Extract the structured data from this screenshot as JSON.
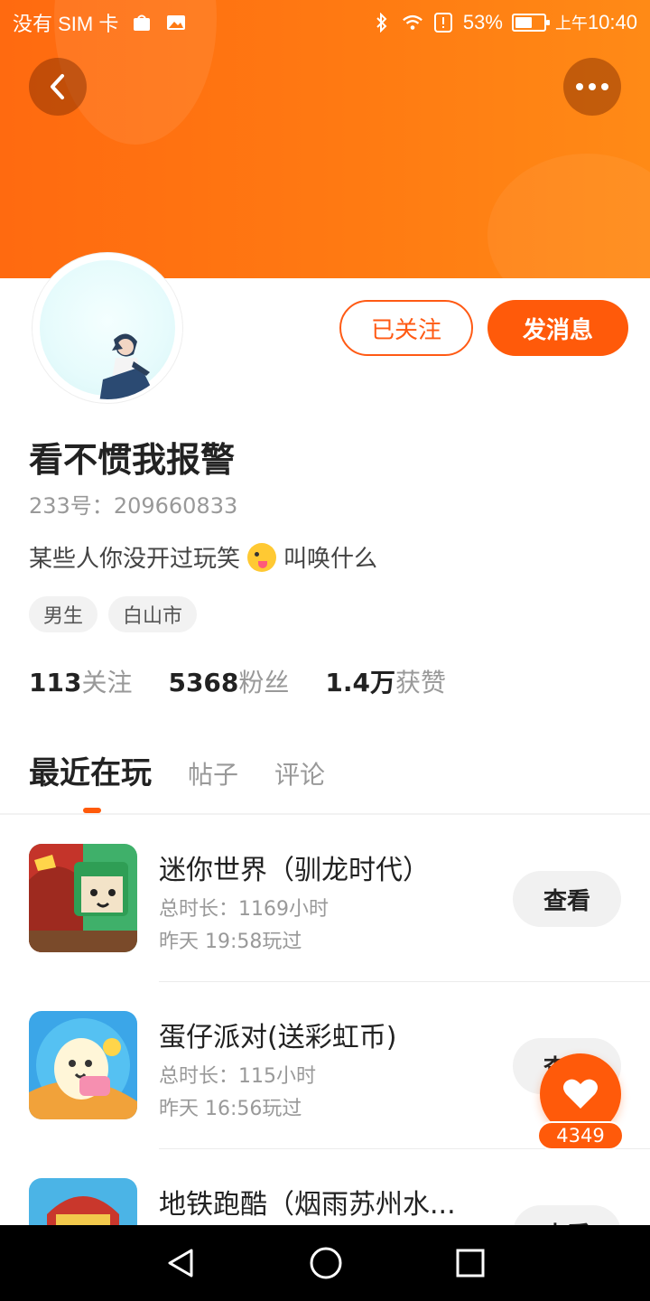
{
  "status_bar": {
    "carrier": "没有 SIM 卡",
    "battery": "53%",
    "time_prefix": "上午",
    "time": "10:40"
  },
  "header": {
    "back_icon": "chevron-left-icon",
    "more_icon": "more-dots-icon"
  },
  "profile": {
    "name": "看不惯我报警",
    "uid_label": "233号：",
    "uid": "209660833",
    "bio_before": "某些人你没开过玩笑",
    "bio_after": " 叫唤什么",
    "tags": [
      "男生",
      "白山市"
    ],
    "follow_button": "已关注",
    "message_button": "发消息"
  },
  "stats": {
    "following_count": "113",
    "following_label": "关注",
    "fans_count": "5368",
    "fans_label": "粉丝",
    "likes_count": "1.4万",
    "likes_label": "获赞"
  },
  "tabs": {
    "active": "最近在玩",
    "posts": "帖子",
    "comments": "评论"
  },
  "games": [
    {
      "title": "迷你世界（驯龙时代）",
      "duration": "总时长：1169小时",
      "last_played": "昨天 19:58玩过",
      "button": "查看"
    },
    {
      "title": "蛋仔派对(送彩虹币)",
      "duration": "总时长：115小时",
      "last_played": "昨天 16:56玩过",
      "button": "查看"
    },
    {
      "title": "地铁跑酷（烟雨苏州水...",
      "button": "查看"
    }
  ],
  "like_fab": {
    "count": "4349"
  },
  "colors": {
    "accent": "#ff5a0a",
    "banner": "#ff7a12"
  }
}
